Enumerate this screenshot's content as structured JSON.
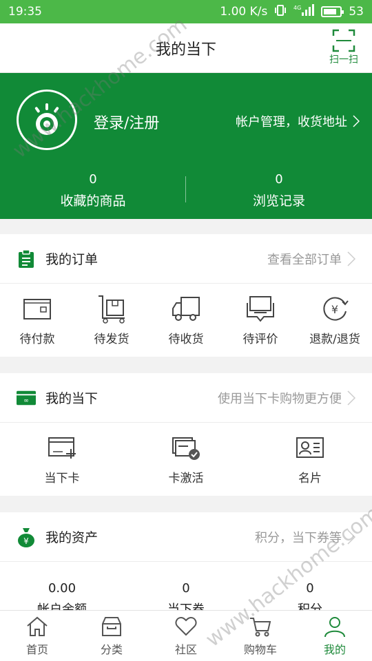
{
  "status": {
    "time": "19:35",
    "speed": "1.00 K/s",
    "net": "4G",
    "battery": "53"
  },
  "header": {
    "title": "我的当下",
    "scan_label": "扫一扫"
  },
  "profile": {
    "login_label": "登录/注册",
    "account_label": "帐户管理，收货地址",
    "stats": [
      {
        "value": "0",
        "label": "收藏的商品"
      },
      {
        "value": "0",
        "label": "浏览记录"
      }
    ]
  },
  "orders": {
    "title": "我的订单",
    "more": "查看全部订单",
    "items": [
      {
        "label": "待付款",
        "icon": "wallet-icon"
      },
      {
        "label": "待发货",
        "icon": "package-cart-icon"
      },
      {
        "label": "待收货",
        "icon": "truck-icon"
      },
      {
        "label": "待评价",
        "icon": "comment-icon"
      },
      {
        "label": "退款/退货",
        "icon": "refund-icon"
      }
    ]
  },
  "mydx": {
    "title": "我的当下",
    "more": "使用当下卡购物更方便",
    "items": [
      {
        "label": "当下卡",
        "icon": "card-plus-icon"
      },
      {
        "label": "卡激活",
        "icon": "card-activate-icon"
      },
      {
        "label": "名片",
        "icon": "business-card-icon"
      }
    ]
  },
  "assets": {
    "title": "我的资产",
    "more": "积分，当下券等",
    "items": [
      {
        "value": "0.00",
        "label": "帐户余额"
      },
      {
        "value": "0",
        "label": "当下券"
      },
      {
        "value": "0",
        "label": "积分"
      }
    ]
  },
  "nav": [
    {
      "label": "首页",
      "icon": "home-icon"
    },
    {
      "label": "分类",
      "icon": "category-icon"
    },
    {
      "label": "社区",
      "icon": "heart-icon"
    },
    {
      "label": "购物车",
      "icon": "cart-icon"
    },
    {
      "label": "我的",
      "icon": "user-icon",
      "active": true
    }
  ],
  "watermark": "www.hackhome.com",
  "colors": {
    "status_bar": "#4cb848",
    "brand_green": "#118a37",
    "accent": "#1f8a3b"
  }
}
